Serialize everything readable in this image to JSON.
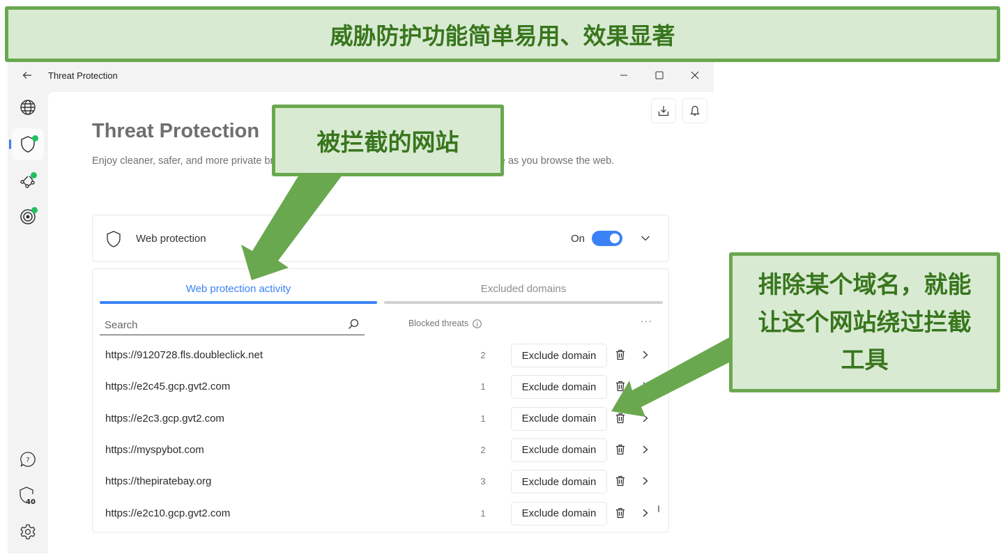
{
  "annotations": {
    "banner": "威胁防护功能简单易用、效果显著",
    "callout_blocked_sites": "被拦截的网站",
    "callout_exclude_domain": "排除某个域名，就能让这个网站绕过拦截工具",
    "color_fill": "#d9ead3",
    "color_border": "#6aa84f",
    "color_text": "#38761d"
  },
  "window": {
    "title": "Threat Protection",
    "back_icon": "arrow-left-icon",
    "controls": [
      "minimize",
      "maximize",
      "close"
    ]
  },
  "sidebar": {
    "top_items": [
      {
        "name": "vpn",
        "icon": "globe-icon",
        "status_dot": false,
        "active": false
      },
      {
        "name": "threat-protection",
        "icon": "shield-icon",
        "status_dot": true,
        "active": true
      },
      {
        "name": "meshnet",
        "icon": "nodes-icon",
        "status_dot": true,
        "active": false
      },
      {
        "name": "dark-web-monitor",
        "icon": "radar-icon",
        "status_dot": true,
        "active": false
      }
    ],
    "bottom_items": [
      {
        "name": "help",
        "icon": "help-bubble-icon"
      },
      {
        "name": "protection-score",
        "icon": "shield-icon",
        "badge": "40"
      },
      {
        "name": "settings",
        "icon": "gear-icon"
      }
    ],
    "accent": "#3b7cf5",
    "dot_color": "#20c05c"
  },
  "header_actions": {
    "download_icon": "download-icon",
    "notifications_icon": "bell-icon"
  },
  "page": {
    "title": "Threat Protection",
    "description": "Enjoy cleaner, safer, and more private browsing. Threat Protection blocks threats in real time as you browse the web."
  },
  "web_protection": {
    "label": "Web protection",
    "state_label": "On",
    "enabled": true,
    "toggle_color": "#3b82f6"
  },
  "activity": {
    "tabs": [
      {
        "label": "Web protection activity",
        "active": true
      },
      {
        "label": "Excluded domains",
        "active": false
      }
    ],
    "search_placeholder": "Search",
    "search_value": "",
    "column_label": "Blocked threats",
    "more_label": "···",
    "exclude_label": "Exclude domain",
    "rows": [
      {
        "url": "https://9120728.fls.doubleclick.net",
        "count": "2"
      },
      {
        "url": "https://e2c45.gcp.gvt2.com",
        "count": "1"
      },
      {
        "url": "https://e2c3.gcp.gvt2.com",
        "count": "1"
      },
      {
        "url": "https://myspybot.com",
        "count": "2"
      },
      {
        "url": "https://thepiratebay.org",
        "count": "3"
      },
      {
        "url": "https://e2c10.gcp.gvt2.com",
        "count": "1"
      }
    ]
  }
}
